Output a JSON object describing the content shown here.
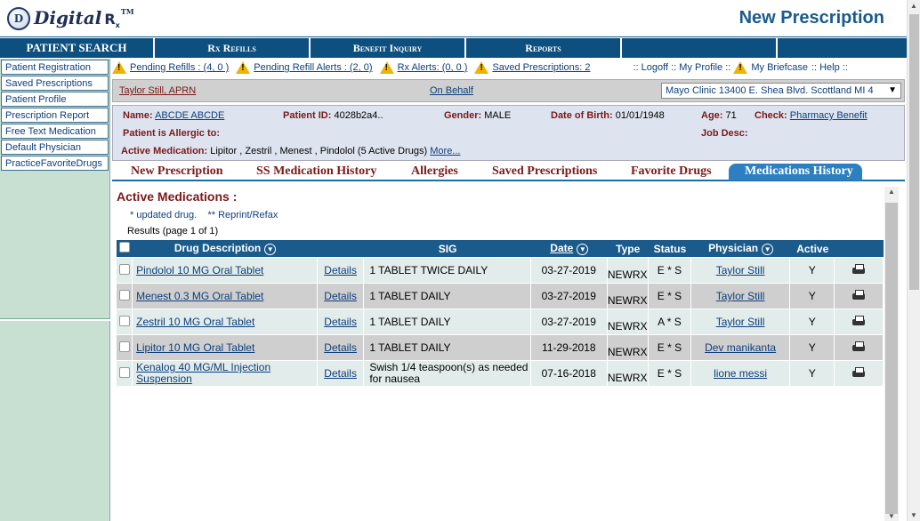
{
  "header": {
    "logo_mark": "D",
    "logo_text": "Digital",
    "logo_rx": "R",
    "logo_rx_sub": "x",
    "logo_tm": "TM",
    "page_title": "New Prescription"
  },
  "topnav": [
    "PATIENT SEARCH",
    "Rx Refills",
    "Benefit Inquiry",
    "Reports",
    "",
    ""
  ],
  "sidebar": {
    "items": [
      "Patient Registration",
      "Saved Prescriptions",
      "Patient Profile",
      "Prescription Report",
      "Free Text Medication",
      "Default Physician",
      "PracticeFavoriteDrugs"
    ]
  },
  "alerts": {
    "pending_refills": "Pending Refills : (4, 0 )",
    "pending_refill_alerts": "Pending Refill Alerts : (2, 0)",
    "rx_alerts": "Rx Alerts: (0, 0 )",
    "saved_prescriptions": "Saved Prescriptions: 2",
    "links": ":: Logoff :: My Profile ::",
    "briefcase": "My Briefcase",
    "help": ":: Help ::"
  },
  "userbar": {
    "user": "Taylor Still, APRN",
    "on_behalf": "On Behalf",
    "clinic": "Mayo Clinic 13400 E. Shea Blvd. Scottland MI 4"
  },
  "patient": {
    "name_label": "Name:",
    "name": "ABCDE ABCDE",
    "id_label": "Patient ID:",
    "id": "4028b2a4..",
    "gender_label": "Gender:",
    "gender": "MALE",
    "dob_label": "Date of Birth:",
    "dob": "01/01/1948",
    "age_label": "Age:",
    "age": "71",
    "check_label": "Check:",
    "check": "Pharmacy Benefit",
    "allergic_label": "Patient is Allergic to:",
    "jobdesc_label": "Job Desc:",
    "active_med_label": "Active Medication:",
    "active_med": "Lipitor , Zestril , Menest , Pindolol (5 Active Drugs)",
    "more": "More..."
  },
  "tabs": [
    "New Prescription",
    "SS Medication History",
    "Allergies",
    "Saved Prescriptions",
    "Favorite Drugs",
    "Medications History"
  ],
  "content": {
    "title": "Active Medications :",
    "legend1": "*  updated drug.",
    "legend2": "** Reprint/Refax",
    "results": "Results (page 1 of 1)",
    "columns": {
      "drug": "Drug Description",
      "sig": "SIG",
      "date": "Date",
      "type": "Type",
      "status": "Status",
      "physician": "Physician",
      "active": "Active"
    },
    "details_label": "Details",
    "rows": [
      {
        "drug": "Pindolol 10 MG Oral Tablet",
        "sig": "1 TABLET TWICE DAILY",
        "date": "03-27-2019",
        "type": "NEWRX",
        "status": "E * S",
        "physician": "Taylor Still",
        "active": "Y"
      },
      {
        "drug": "Menest 0.3 MG Oral Tablet",
        "sig": "1 TABLET DAILY",
        "date": "03-27-2019",
        "type": "NEWRX",
        "status": "E * S",
        "physician": "Taylor Still",
        "active": "Y"
      },
      {
        "drug": "Zestril 10 MG Oral Tablet",
        "sig": "1 TABLET DAILY",
        "date": "03-27-2019",
        "type": "NEWRX",
        "status": "A * S",
        "physician": "Taylor Still",
        "active": "Y"
      },
      {
        "drug": "Lipitor 10 MG Oral Tablet",
        "sig": "1 TABLET DAILY",
        "date": "11-29-2018",
        "type": "NEWRX",
        "status": "E * S",
        "physician": "Dev manikanta",
        "active": "Y"
      },
      {
        "drug": "Kenalog 40 MG/ML Injection Suspension",
        "sig": "Swish 1/4 teaspoon(s) as needed for nausea",
        "date": "07-16-2018",
        "type": "NEWRX",
        "status": "E * S",
        "physician": "lione messi",
        "active": "Y"
      }
    ]
  },
  "colors": {
    "nav_bg": "#0d4f7e",
    "title_blue": "#1a5b8c",
    "label_maroon": "#7a1a1a",
    "link_blue": "#0d3f7c",
    "sidebar_bg": "#c8e0d2"
  }
}
